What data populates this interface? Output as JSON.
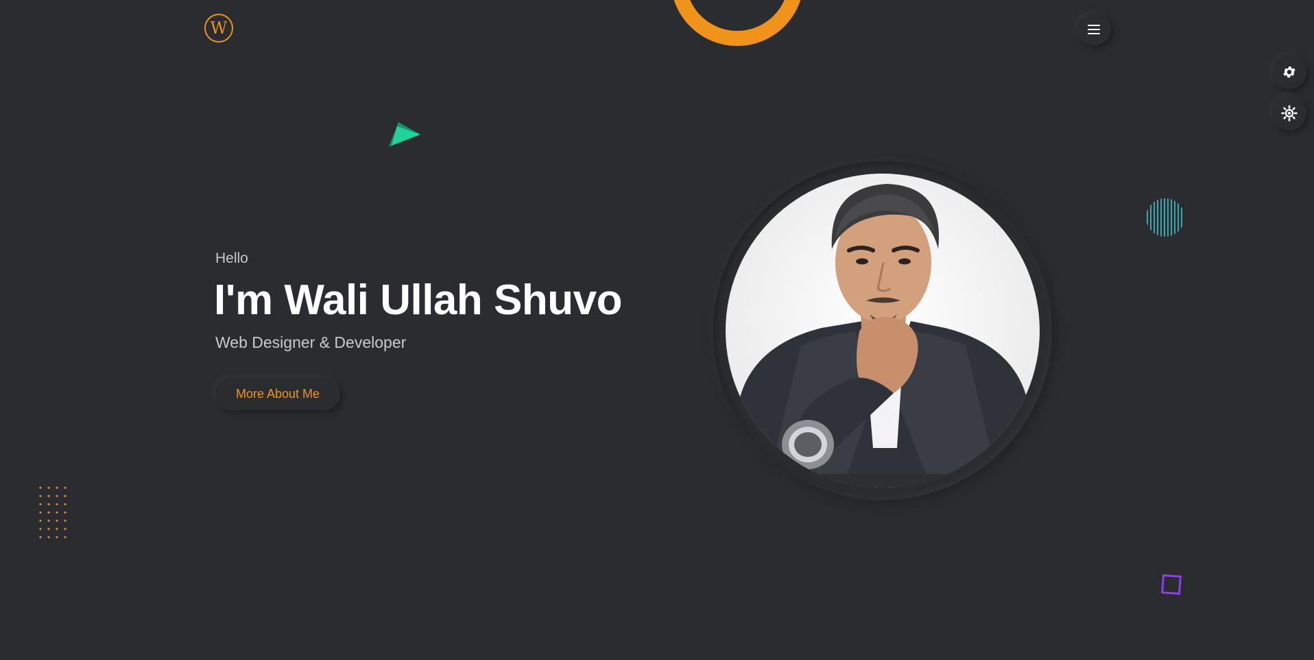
{
  "header": {
    "logo_text": "W",
    "menu_label": "Menu"
  },
  "hero": {
    "greeting": "Hello",
    "name": "I'm Wali Ullah Shuvo",
    "role": "Web Designer & Developer",
    "cta_label": "More About Me"
  },
  "side_controls": [
    {
      "icon": "gear-icon"
    },
    {
      "icon": "sun-icon"
    }
  ],
  "profile": {
    "icon": "profile-photo"
  },
  "colors": {
    "background": "#2b2c30",
    "accent": "#f0931a",
    "green": "#20d39a",
    "teal": "#3ec6cf",
    "purple": "#8b3ff0",
    "text": "#ffffff",
    "muted_text": "#c9cacd"
  }
}
